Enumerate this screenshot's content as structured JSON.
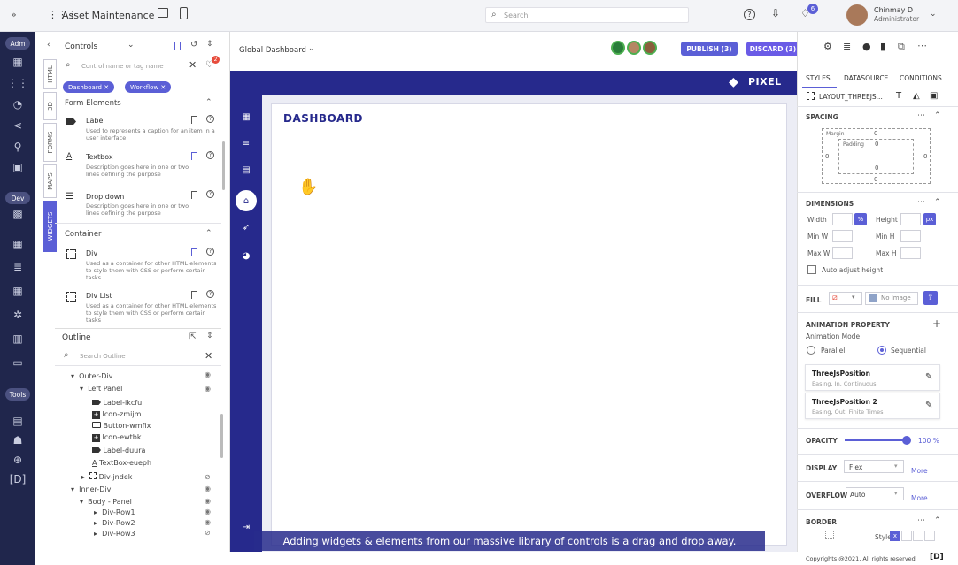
{
  "colors": {
    "rail": "#20264c",
    "accent": "#5b5fd6",
    "navy": "#26298c",
    "publish": "#5b5fd6",
    "discard": "#6a5be6"
  },
  "topbar": {
    "app_title": "Asset Maintenance",
    "search_placeholder": "Search",
    "notification_count": "6",
    "user_name": "Chinmay D",
    "user_role": "Administrator"
  },
  "rail": {
    "adm": "Adm",
    "dev": "Dev",
    "tools": "Tools"
  },
  "left": {
    "header": "Controls",
    "search_placeholder": "Control name or tag name",
    "filter_badge": "2",
    "chips": [
      "Dashboard",
      "Workflow"
    ],
    "vtabs": [
      "HTML",
      "3D",
      "FORMS",
      "MAPS",
      "WIDGETS"
    ],
    "form_section": "Form Elements",
    "form_items": [
      {
        "name": "Label",
        "desc1": "Used to represents a caption for an item in a",
        "desc2": "user interface"
      },
      {
        "name": "Textbox",
        "desc1": "Description goes here in one or two",
        "desc2": "lines defining the purpose"
      },
      {
        "name": "Drop down",
        "desc1": "Description goes here in one or two",
        "desc2": "lines defining the purpose"
      }
    ],
    "container_section": "Container",
    "container_items": [
      {
        "name": "Div",
        "desc1": "Used as a container for other HTML elements",
        "desc2": "to style them with CSS or perform certain",
        "desc3": "tasks"
      },
      {
        "name": "Div List",
        "desc1": "Used as a container for other HTML elements",
        "desc2": "to style them with CSS or perform certain",
        "desc3": "tasks"
      }
    ],
    "outline_header": "Outline",
    "outline_search": "Search Outline",
    "outline": [
      "Outer-Div",
      "Left Panel",
      "Label-ikcfu",
      "Icon-zmijm",
      "Button-wmfix",
      "Icon-ewtbk",
      "Label-duura",
      "TextBox-eueph",
      "Div-jndek",
      "Inner-Div",
      "Body - Panel",
      "Div-Row1",
      "Div-Row2",
      "Div-Row3"
    ]
  },
  "center": {
    "dashboard_selector": "Global Dashboard",
    "publish": "PUBLISH (3)",
    "discard": "DISCARD (3)",
    "brand": "PIXEL",
    "page_title": "DASHBOARD",
    "banner": "Adding widgets & elements  from our massive library of controls is a drag and drop away."
  },
  "right": {
    "tabs": [
      "STYLES",
      "DATASOURCE",
      "CONDITIONS"
    ],
    "layout_name": "LAYOUT_THREEJS...",
    "spacing": "SPACING",
    "margin_label": "Margin",
    "padding_label": "Padding",
    "zero": "0",
    "dimensions": "DIMENSIONS",
    "width": "Width",
    "height": "Height",
    "min_w": "Min W",
    "min_h": "Min H",
    "max_w": "Max W",
    "max_h": "Max H",
    "pct": "%",
    "px": "px",
    "auto_adjust": "Auto adjust height",
    "fill": "FILL",
    "no_image": "No Image",
    "animation": "ANIMATION PROPERTY",
    "animation_mode": "Animation Mode",
    "parallel": "Parallel",
    "sequential": "Sequential",
    "anim1_title": "ThreeJsPosition",
    "anim1_sub": "Easing, In, Continuous",
    "anim2_title": "ThreeJsPosition 2",
    "anim2_sub": "Easing, Out, Finite Times",
    "opacity": "OPACITY",
    "opacity_value": "100 %",
    "opacity_level": 1.0,
    "display": "DISPLAY",
    "display_value": "Flex",
    "overflow": "OVERFLOW",
    "overflow_value": "Auto",
    "more": "More",
    "border": "BORDER",
    "style": "Style",
    "x": "x"
  },
  "footer": {
    "copyright": "Copyrights @2021, All rights reserved",
    "logo": "[D]"
  }
}
